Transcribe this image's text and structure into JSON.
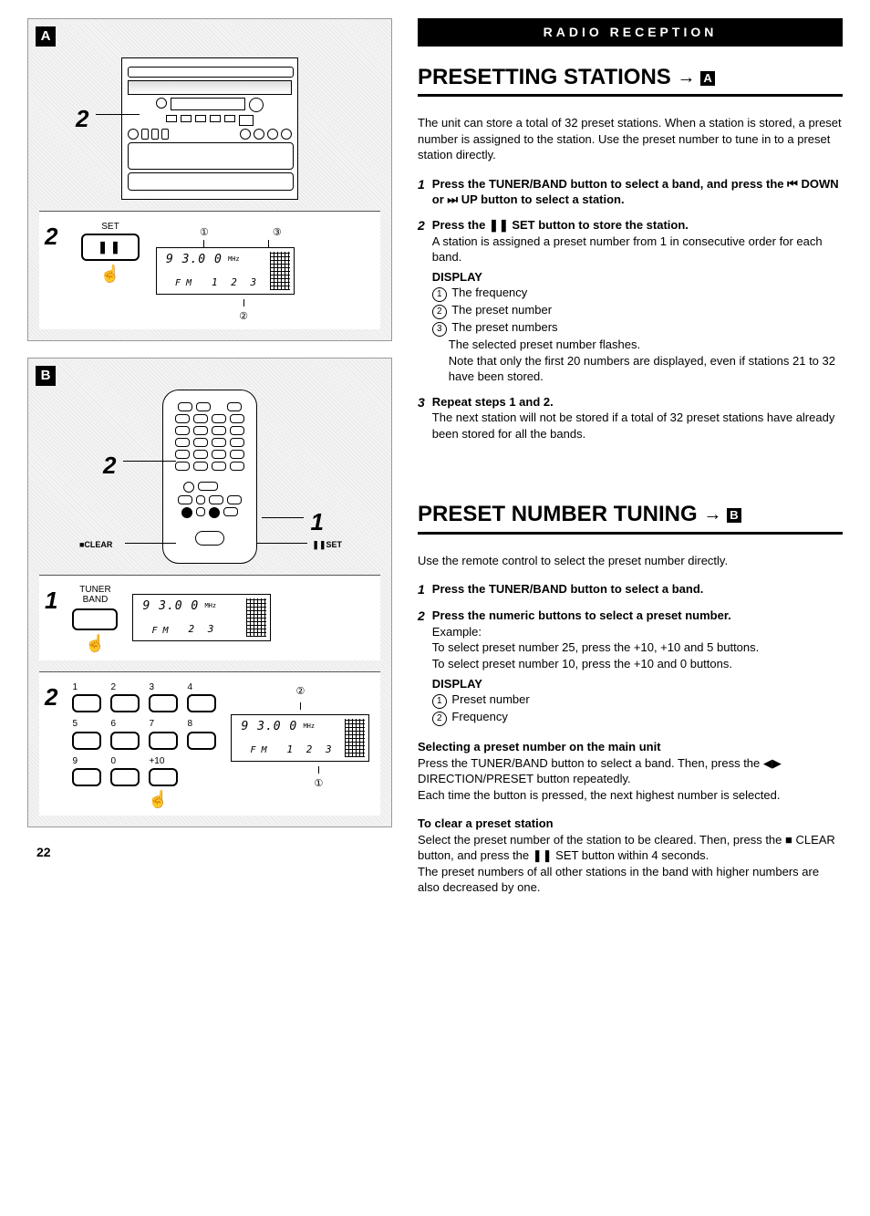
{
  "banner": "RADIO RECEPTION",
  "page_number": "22",
  "figA": {
    "label": "A",
    "callout2": "2",
    "sub": {
      "num": "2",
      "set_label": "SET",
      "pause": "❚❚",
      "c1": "①",
      "c2": "②",
      "c3": "③",
      "lcd_freq": "9 3.0 0",
      "lcd_mhz": "MHz",
      "lcd_band": "F M",
      "lcd_digits": "1 2 3"
    }
  },
  "figB": {
    "label": "B",
    "callout1": "1",
    "callout2": "2",
    "clear_label": "■CLEAR",
    "set_label": "❚❚SET",
    "sub1": {
      "num": "1",
      "tuner": "TUNER",
      "band": "BAND",
      "lcd_freq": "9 3.0 0",
      "lcd_mhz": "MHz",
      "lcd_band": "F M",
      "lcd_digits": "2 3"
    },
    "sub2": {
      "num": "2",
      "keys": [
        "1",
        "2",
        "3",
        "4",
        "5",
        "6",
        "7",
        "8",
        "9",
        "0",
        "+10"
      ],
      "c1": "①",
      "c2": "②",
      "lcd_freq": "9 3.0 0",
      "lcd_mhz": "MHz",
      "lcd_band": "F M",
      "lcd_digits": "1 2 3"
    }
  },
  "sectA": {
    "heading": "PRESETTING STATIONS",
    "heading_ref": "A",
    "intro": "The unit can store a total of 32 preset stations.  When a station is stored, a preset number is assigned to the station.  Use the preset number to tune in to a preset station directly.",
    "step1_num": "1",
    "step1_title": "Press the TUNER/BAND button to select a band, and press the ⏮ DOWN or ⏭ UP button to select a station.",
    "step2_num": "2",
    "step2_title": "Press the ❚❚ SET button to store the station.",
    "step2_line1": "A station is assigned a preset number from 1 in consecutive order for each band.",
    "step2_display": "DISPLAY",
    "step2_d1": "The frequency",
    "step2_d2": "The preset number",
    "step2_d3": "The preset numbers",
    "step2_d3b": "The selected preset number flashes.",
    "step2_d3c": "Note that only the first 20 numbers are displayed, even if stations 21 to 32 have been stored.",
    "step3_num": "3",
    "step3_title": "Repeat steps 1 and 2.",
    "step3_line1": "The next station will not be stored if a total of 32 preset stations have already been stored for all the bands."
  },
  "sectB": {
    "heading": "PRESET NUMBER TUNING",
    "heading_ref": "B",
    "intro": "Use the remote control to select the preset number directly.",
    "step1_num": "1",
    "step1_title": "Press the TUNER/BAND button to select a band.",
    "step2_num": "2",
    "step2_title": "Press the numeric buttons to select a preset number.",
    "step2_ex": "Example:",
    "step2_ex1": "To select preset number 25, press the +10, +10 and 5 buttons.",
    "step2_ex2": "To select preset number 10, press the +10 and 0 buttons.",
    "step2_display": "DISPLAY",
    "step2_d1": "Preset number",
    "step2_d2": "Frequency",
    "sel_title": "Selecting a preset number on the main unit",
    "sel_line1": "Press the TUNER/BAND button to select a band. Then, press the ◀▶ DIRECTION/PRESET button repeatedly.",
    "sel_line2": "Each time the button is pressed, the next highest number is selected.",
    "clr_title": "To clear a preset station",
    "clr_line1": "Select the preset number of the station to be cleared. Then, press the ■ CLEAR button, and press the ❚❚ SET button within 4 seconds.",
    "clr_line2": "The preset numbers of all other stations in the band with higher numbers are also decreased by one."
  }
}
